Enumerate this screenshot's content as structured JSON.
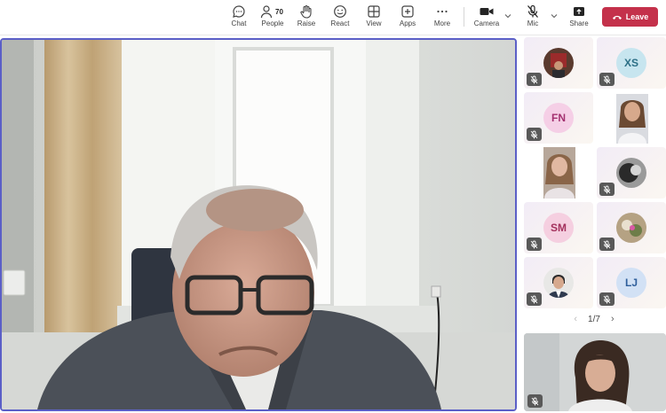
{
  "toolbar": {
    "chat": {
      "label": "Chat",
      "icon": "chat-icon"
    },
    "people": {
      "label": "People",
      "count": "70",
      "icon": "people-icon"
    },
    "raise": {
      "label": "Raise",
      "icon": "hand-icon"
    },
    "react": {
      "label": "React",
      "icon": "emoji-icon"
    },
    "view": {
      "label": "View",
      "icon": "grid-icon"
    },
    "apps": {
      "label": "Apps",
      "icon": "plus-square-icon"
    },
    "more": {
      "label": "More",
      "icon": "ellipsis-icon"
    },
    "camera": {
      "label": "Camera",
      "icon": "video-camera-icon"
    },
    "mic": {
      "label": "Mic",
      "icon": "mic-muted-icon"
    },
    "share": {
      "label": "Share",
      "icon": "share-tray-icon"
    },
    "leave": {
      "label": "Leave",
      "icon": "phone-hangup-icon",
      "color": "#c4314b"
    }
  },
  "gallery": {
    "participants": [
      {
        "type": "photo",
        "muted": true
      },
      {
        "type": "initials",
        "initials": "XS",
        "color": "#c7e5ef",
        "text_color": "#2c6f86",
        "muted": true
      },
      {
        "type": "initials",
        "initials": "FN",
        "color": "#f5cfe6",
        "text_color": "#a3306f",
        "muted": true
      },
      {
        "type": "photo",
        "muted": false
      },
      {
        "type": "photo",
        "muted": false
      },
      {
        "type": "photo",
        "muted": true
      },
      {
        "type": "initials",
        "initials": "SM",
        "color": "#f5cfe0",
        "text_color": "#a3305c",
        "muted": true
      },
      {
        "type": "photo",
        "muted": true
      },
      {
        "type": "photo",
        "muted": true
      },
      {
        "type": "initials",
        "initials": "LJ",
        "color": "#d2e1f5",
        "text_color": "#2f5f9c",
        "muted": true
      }
    ],
    "pager": {
      "text": "1/7"
    }
  },
  "accent_color": "#5b5fc7"
}
